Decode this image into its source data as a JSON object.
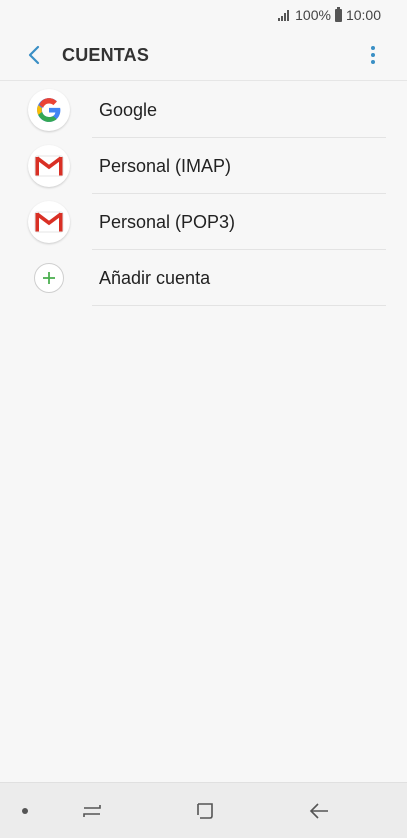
{
  "status_bar": {
    "battery_percent": "100%",
    "time": "10:00",
    "icons": [
      "signal-icon",
      "battery-icon"
    ]
  },
  "app_bar": {
    "title": "CUENTAS",
    "back_icon": "back-arrow-icon",
    "more_icon": "more-vert-icon",
    "accent_color": "#3a8fc5"
  },
  "accounts": [
    {
      "label": "Google",
      "icon": "google-icon"
    },
    {
      "label": "Personal (IMAP)",
      "icon": "gmail-icon"
    },
    {
      "label": "Personal (POP3)",
      "icon": "gmail-icon"
    },
    {
      "label": "Añadir cuenta",
      "icon": "add-icon"
    }
  ],
  "nav_bar": {
    "icons": [
      "recent-apps-icon",
      "home-icon",
      "back-icon"
    ]
  }
}
